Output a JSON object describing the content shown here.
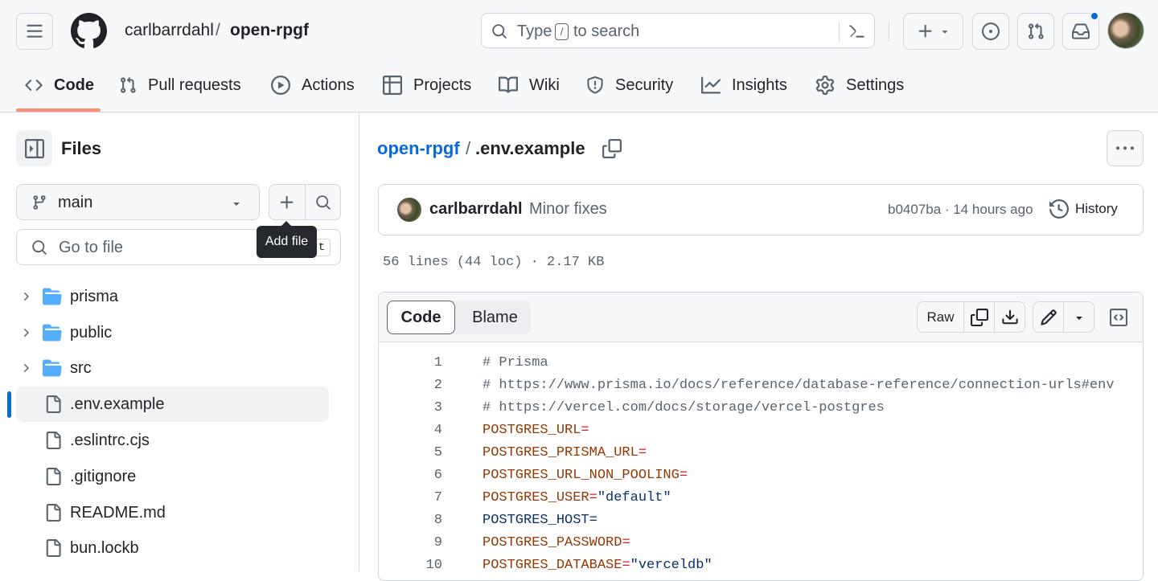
{
  "header": {
    "owner": "carlbarrdahl",
    "separator": "/",
    "repo": "open-rpgf",
    "search_prefix": "Type",
    "search_key": "/",
    "search_suffix": "to search"
  },
  "nav": {
    "tabs": [
      {
        "label": "Code",
        "icon": "code-icon"
      },
      {
        "label": "Pull requests",
        "icon": "pull-request-icon"
      },
      {
        "label": "Actions",
        "icon": "play-icon"
      },
      {
        "label": "Projects",
        "icon": "table-icon"
      },
      {
        "label": "Wiki",
        "icon": "book-icon"
      },
      {
        "label": "Security",
        "icon": "shield-icon"
      },
      {
        "label": "Insights",
        "icon": "graph-icon"
      },
      {
        "label": "Settings",
        "icon": "gear-icon"
      }
    ]
  },
  "sidebar": {
    "title": "Files",
    "branch": "main",
    "goto_placeholder": "Go to file",
    "goto_shortcut": "t",
    "tooltip": "Add file",
    "items": [
      {
        "name": "prisma",
        "type": "folder"
      },
      {
        "name": "public",
        "type": "folder"
      },
      {
        "name": "src",
        "type": "folder"
      },
      {
        "name": ".env.example",
        "type": "file",
        "selected": true
      },
      {
        "name": ".eslintrc.cjs",
        "type": "file"
      },
      {
        "name": ".gitignore",
        "type": "file"
      },
      {
        "name": "README.md",
        "type": "file"
      },
      {
        "name": "bun.lockb",
        "type": "file"
      }
    ]
  },
  "file": {
    "repo_link": "open-rpgf",
    "separator": "/",
    "name": ".env.example",
    "commit_author": "carlbarrdahl",
    "commit_message": "Minor fixes",
    "commit_meta": "b0407ba · 14 hours ago",
    "history_label": "History",
    "stats": "56 lines (44 loc) · 2.17 KB",
    "tab_code": "Code",
    "tab_blame": "Blame",
    "raw_label": "Raw"
  },
  "code": {
    "lines": [
      {
        "n": "1",
        "parts": [
          {
            "t": "# Prisma",
            "c": "cm"
          }
        ]
      },
      {
        "n": "2",
        "parts": [
          {
            "t": "# https://www.prisma.io/docs/reference/database-reference/connection-urls#env",
            "c": "cm"
          }
        ]
      },
      {
        "n": "3",
        "parts": [
          {
            "t": "# https://vercel.com/docs/storage/vercel-postgres",
            "c": "cm"
          }
        ]
      },
      {
        "n": "4",
        "parts": [
          {
            "t": "POSTGRES_URL",
            "c": "var"
          },
          {
            "t": "=",
            "c": "op"
          }
        ]
      },
      {
        "n": "5",
        "parts": [
          {
            "t": "POSTGRES_PRISMA_URL",
            "c": "var"
          },
          {
            "t": "=",
            "c": "op"
          }
        ]
      },
      {
        "n": "6",
        "parts": [
          {
            "t": "POSTGRES_URL_NON_POOLING",
            "c": "var"
          },
          {
            "t": "=",
            "c": "op"
          }
        ]
      },
      {
        "n": "7",
        "parts": [
          {
            "t": "POSTGRES_USER",
            "c": "var"
          },
          {
            "t": "=",
            "c": "op"
          },
          {
            "t": "\"default\"",
            "c": "str"
          }
        ]
      },
      {
        "n": "8",
        "parts": [
          {
            "t": "POSTGRES_HOST=",
            "c": "plain"
          }
        ]
      },
      {
        "n": "9",
        "parts": [
          {
            "t": "POSTGRES_PASSWORD",
            "c": "var"
          },
          {
            "t": "=",
            "c": "op"
          }
        ]
      },
      {
        "n": "10",
        "parts": [
          {
            "t": "POSTGRES_DATABASE",
            "c": "var"
          },
          {
            "t": "=",
            "c": "op"
          },
          {
            "t": "\"verceldb\"",
            "c": "str"
          }
        ]
      }
    ]
  },
  "colors": {
    "accent": "#0969da",
    "tab_underline": "#fd8c73",
    "notification": "#0969da"
  }
}
